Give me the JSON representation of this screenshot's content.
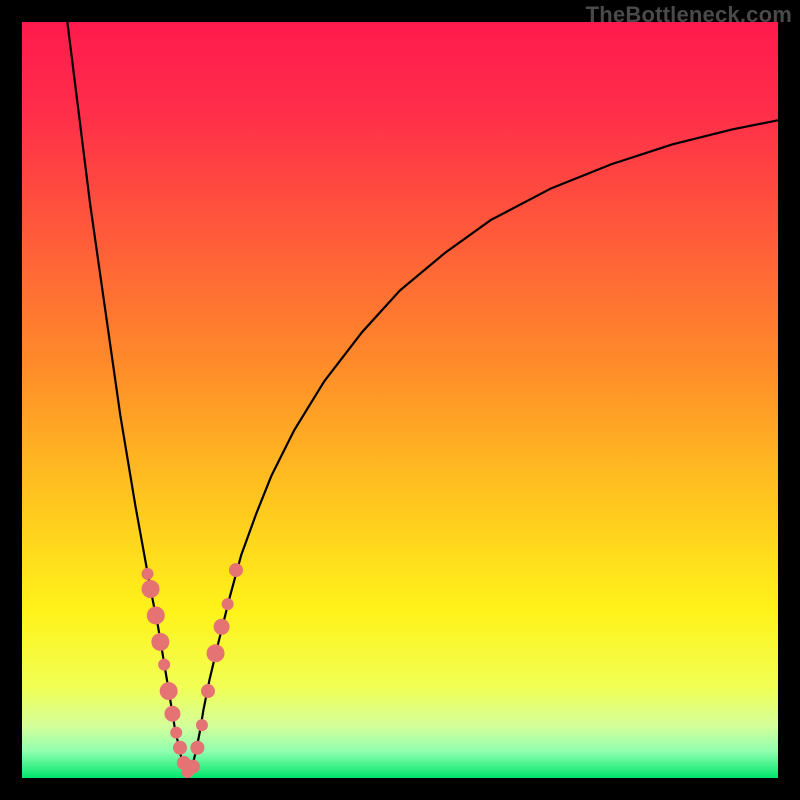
{
  "watermark": "TheBottleneck.com",
  "colors": {
    "frame": "#000000",
    "gradient_stops": [
      {
        "pos": 0.0,
        "color": "#ff1a4d"
      },
      {
        "pos": 0.12,
        "color": "#ff2e4a"
      },
      {
        "pos": 0.28,
        "color": "#ff5a3a"
      },
      {
        "pos": 0.45,
        "color": "#ff8a2a"
      },
      {
        "pos": 0.62,
        "color": "#ffc21f"
      },
      {
        "pos": 0.78,
        "color": "#fff31a"
      },
      {
        "pos": 0.88,
        "color": "#f1ff55"
      },
      {
        "pos": 0.93,
        "color": "#d6ff9a"
      },
      {
        "pos": 0.965,
        "color": "#8fffb0"
      },
      {
        "pos": 1.0,
        "color": "#00e66b"
      }
    ],
    "curve": "#000000",
    "marker_fill": "#e57373",
    "marker_stroke": "#c95f5f"
  },
  "chart_data": {
    "type": "line",
    "title": "",
    "xlabel": "",
    "ylabel": "",
    "xlim": [
      0,
      100
    ],
    "ylim": [
      0,
      100
    ],
    "grid": false,
    "legend": false,
    "series": [
      {
        "name": "left-branch",
        "x": [
          6,
          7,
          8,
          9,
          10,
          11,
          12,
          13,
          14,
          15,
          16,
          17,
          18,
          18.5,
          19,
          19.5,
          20,
          20.3,
          20.7,
          21,
          21.3,
          21.7,
          22
        ],
        "y": [
          100,
          92,
          84,
          76,
          69,
          62,
          55,
          48,
          42,
          36,
          30.5,
          25,
          20,
          17,
          14,
          11,
          8,
          6,
          4.5,
          3,
          2,
          1,
          0
        ]
      },
      {
        "name": "right-branch",
        "x": [
          22,
          22.5,
          23,
          23.5,
          24,
          24.8,
          26,
          27.5,
          29,
          31,
          33,
          36,
          40,
          45,
          50,
          56,
          62,
          70,
          78,
          86,
          94,
          100
        ],
        "y": [
          0,
          1.5,
          3.5,
          6,
          9,
          13,
          18,
          24,
          29.5,
          35,
          40,
          46,
          52.5,
          59,
          64.5,
          69.5,
          73.8,
          78,
          81.2,
          83.8,
          85.8,
          87
        ]
      }
    ],
    "markers": [
      {
        "x": 16.6,
        "y": 27.0,
        "r": 6
      },
      {
        "x": 17.0,
        "y": 25.0,
        "r": 9
      },
      {
        "x": 17.7,
        "y": 21.5,
        "r": 9
      },
      {
        "x": 18.3,
        "y": 18.0,
        "r": 9
      },
      {
        "x": 18.8,
        "y": 15.0,
        "r": 6
      },
      {
        "x": 19.4,
        "y": 11.5,
        "r": 9
      },
      {
        "x": 19.9,
        "y": 8.5,
        "r": 8
      },
      {
        "x": 20.4,
        "y": 6.0,
        "r": 6
      },
      {
        "x": 20.9,
        "y": 4.0,
        "r": 7
      },
      {
        "x": 21.4,
        "y": 2.0,
        "r": 7
      },
      {
        "x": 21.9,
        "y": 0.8,
        "r": 6
      },
      {
        "x": 22.6,
        "y": 1.5,
        "r": 7
      },
      {
        "x": 23.2,
        "y": 4.0,
        "r": 7
      },
      {
        "x": 23.8,
        "y": 7.0,
        "r": 6
      },
      {
        "x": 24.6,
        "y": 11.5,
        "r": 7
      },
      {
        "x": 25.6,
        "y": 16.5,
        "r": 9
      },
      {
        "x": 26.4,
        "y": 20.0,
        "r": 8
      },
      {
        "x": 27.2,
        "y": 23.0,
        "r": 6
      },
      {
        "x": 28.3,
        "y": 27.5,
        "r": 7
      }
    ]
  }
}
